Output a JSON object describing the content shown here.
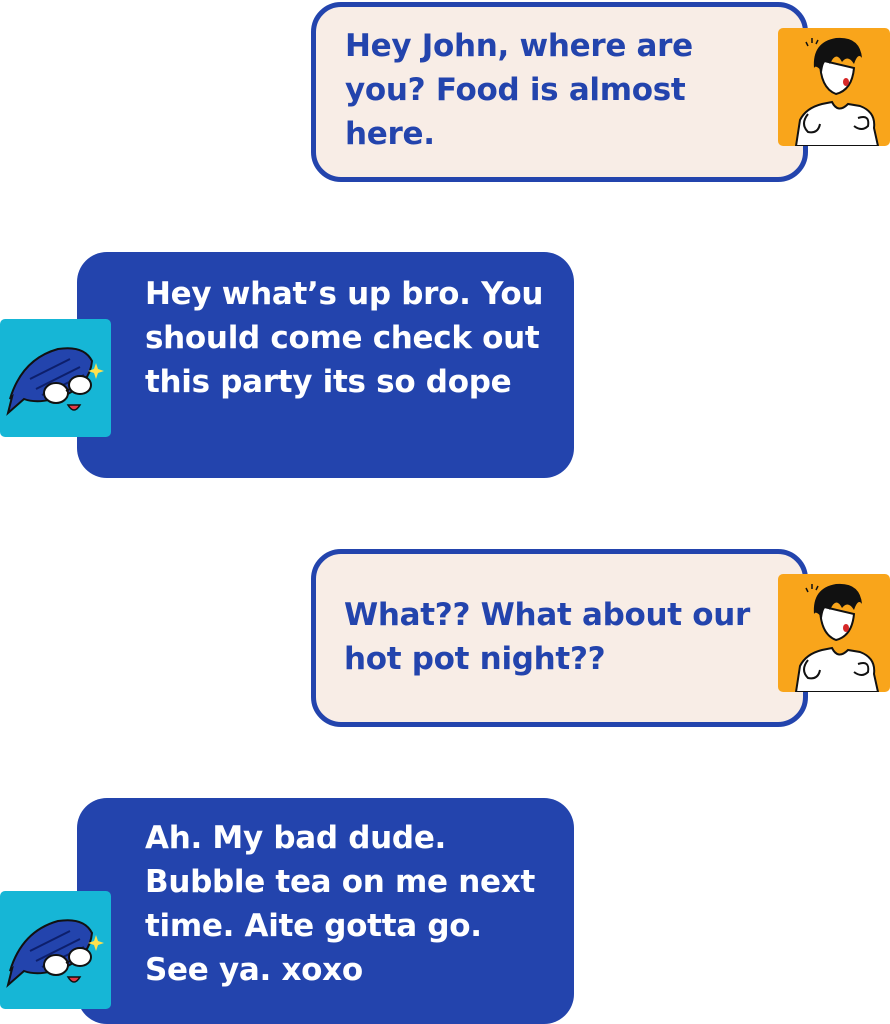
{
  "messages": [
    {
      "sender": "me",
      "text": "Hey John, where are you? Food is almost here.",
      "avatar": "orange-person-avatar-icon"
    },
    {
      "sender": "john",
      "text": "Hey what’s up bro. You should come check out this party its so dope",
      "avatar": "blue-fish-sunglasses-avatar-icon"
    },
    {
      "sender": "me",
      "text": "What?? What about our hot pot night??",
      "avatar": "orange-person-avatar-icon"
    },
    {
      "sender": "john",
      "text": "Ah. My bad dude. Bubble tea on me next time. Aite gotta go. See ya. xoxo",
      "avatar": "blue-fish-sunglasses-avatar-icon"
    }
  ],
  "colors": {
    "bubble_blue": "#2344ad",
    "bubble_cream": "#f8ede6",
    "avatar_orange": "#f9a51b",
    "avatar_cyan": "#16b6d6"
  }
}
